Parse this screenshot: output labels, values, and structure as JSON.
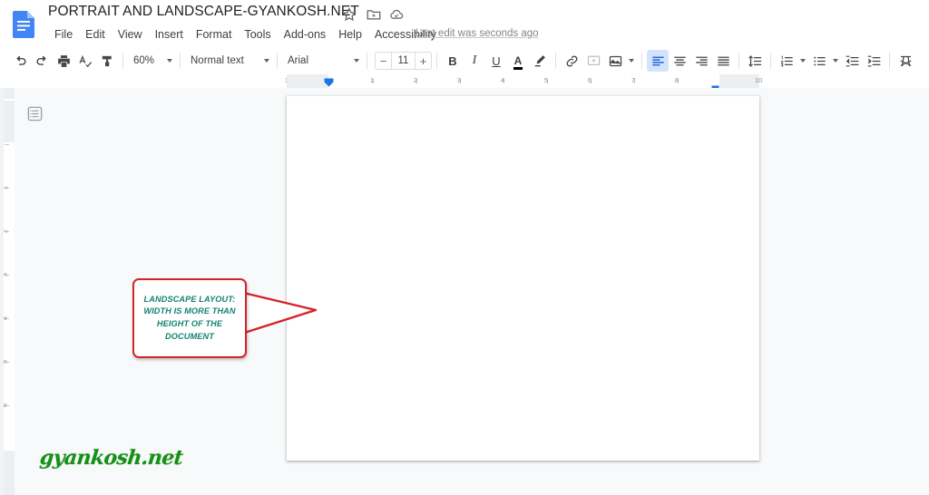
{
  "app": {
    "logo_icon": "google-docs-logo-icon",
    "document_title": "PORTRAIT AND LANDSCAPE-GYANKOSH.NET",
    "title_icons": [
      {
        "name": "star-icon",
        "label": "Star"
      },
      {
        "name": "move-to-folder-icon",
        "label": "Move"
      },
      {
        "name": "cloud-saved-icon",
        "label": "Saved to Drive"
      }
    ],
    "last_edit": "Last edit was seconds ago"
  },
  "menubar": {
    "items": [
      {
        "label": "File"
      },
      {
        "label": "Edit"
      },
      {
        "label": "View"
      },
      {
        "label": "Insert"
      },
      {
        "label": "Format"
      },
      {
        "label": "Tools"
      },
      {
        "label": "Add-ons"
      },
      {
        "label": "Help"
      },
      {
        "label": "Accessibility"
      }
    ]
  },
  "toolbar": {
    "undo_icon": "undo-icon",
    "redo_icon": "redo-icon",
    "print_icon": "print-icon",
    "spellcheck_icon": "spellcheck-icon",
    "paint_format_icon": "paint-format-icon",
    "zoom_value": "60%",
    "paragraph_style": "Normal text",
    "font_family": "Arial",
    "font_size": "11",
    "font_decrease": "−",
    "font_increase": "+",
    "bold_label": "B",
    "italic_label": "I",
    "underline_label": "U",
    "text_color_label": "A",
    "text_color_swatch": "#000000",
    "highlight_icon": "highlight-pen-icon",
    "link_icon": "insert-link-icon",
    "comment_icon": "add-comment-icon",
    "image_icon": "insert-image-icon",
    "align_left_icon": "align-left-icon",
    "align_center_icon": "align-center-icon",
    "align_right_icon": "align-right-icon",
    "align_justify_icon": "align-justify-icon",
    "line_spacing_icon": "line-spacing-icon",
    "numbered_list_icon": "numbered-list-icon",
    "bulleted_list_icon": "bulleted-list-icon",
    "decrease_indent_icon": "decrease-indent-icon",
    "increase_indent_icon": "increase-indent-icon",
    "clear_formatting_icon": "clear-formatting-icon",
    "active_alignment": "align-left"
  },
  "rulers": {
    "horizontal_numbers": [
      "1",
      "1",
      "2",
      "3",
      "4",
      "5",
      "6",
      "7",
      "8",
      "10"
    ],
    "vertical_numbers": [
      "1",
      "2",
      "3",
      "4",
      "5",
      "6"
    ],
    "left_indent_icon": "left-indent-marker-icon",
    "right_indent_icon": "right-indent-marker-icon"
  },
  "canvas": {
    "outline_icon": "document-outline-icon",
    "page_orientation": "landscape"
  },
  "callout": {
    "text": "LANDSCAPE LAYOUT: WIDTH IS MORE THAN HEIGHT OF THE DOCUMENT",
    "border_color": "#d4232b",
    "text_color": "#138372"
  },
  "watermark": {
    "text": "gyankosh.net",
    "color": "#169016"
  }
}
